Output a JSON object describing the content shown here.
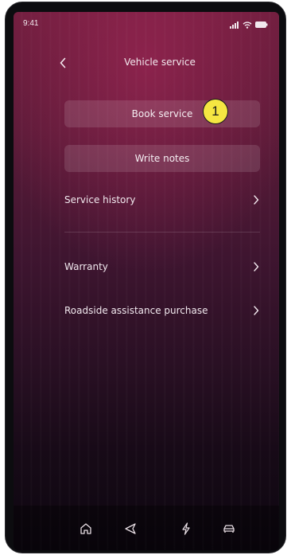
{
  "status_bar": {
    "time": "9:41"
  },
  "header": {
    "title": "Vehicle service"
  },
  "actions": {
    "book_service_label": "Book service",
    "write_notes_label": "Write notes"
  },
  "annotation": {
    "badge_number": "1",
    "badge_color": "#f5e642"
  },
  "menu": {
    "items": [
      {
        "label": "Service history"
      },
      {
        "label": "Warranty"
      },
      {
        "label": "Roadside assistance purchase"
      }
    ]
  },
  "tab_bar": {
    "tabs": [
      {
        "icon": "home-icon"
      },
      {
        "icon": "navigation-arrow-icon"
      },
      {
        "icon": "lightning-icon"
      },
      {
        "icon": "car-icon"
      }
    ]
  },
  "colors": {
    "background_top": "#6f1e3e",
    "background_bottom": "#0d0710",
    "text": "#f3e9ef"
  }
}
